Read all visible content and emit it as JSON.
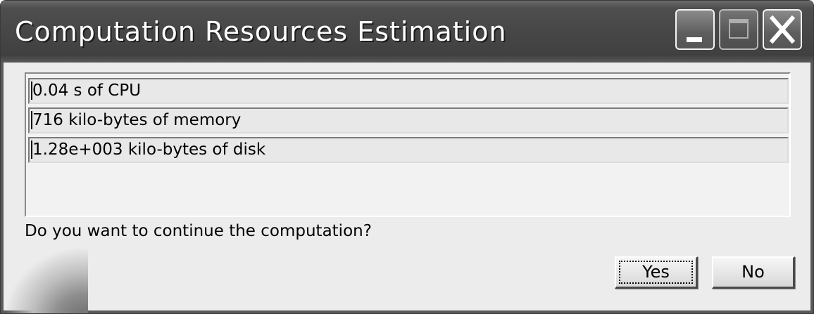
{
  "window": {
    "title": "Computation Resources Estimation",
    "controls": {
      "minimize_icon": "minimize-icon",
      "maximize_icon": "maximize-icon",
      "close_icon": "close-icon"
    }
  },
  "estimates": [
    {
      "text": "0.04 s of CPU"
    },
    {
      "text": "716 kilo-bytes of memory"
    },
    {
      "text": "1.28e+003 kilo-bytes of disk"
    }
  ],
  "prompt": "Do you want to continue the computation?",
  "buttons": {
    "yes_label": "Yes",
    "no_label": "No"
  }
}
